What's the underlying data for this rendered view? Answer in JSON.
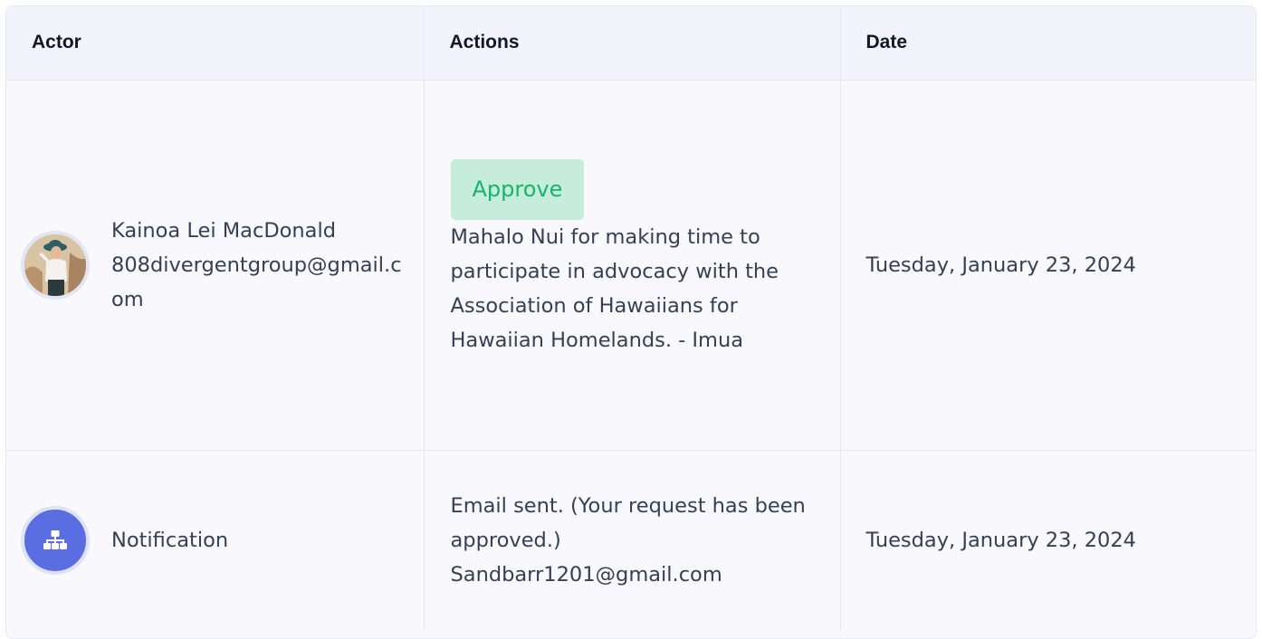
{
  "table": {
    "headers": {
      "actor": "Actor",
      "actions": "Actions",
      "date": "Date"
    },
    "rows": [
      {
        "actor_name": "Kainoa Lei MacDonald",
        "actor_email": "808divergentgroup@gmail.com",
        "avatar_icon": "user-photo-avatar",
        "action_badge": "Approve",
        "action_text": "Mahalo Nui for making time to participate in advocacy with the Association of Hawaiians for Hawaiian Homelands. - Imua",
        "date": "Tuesday, January 23, 2024"
      },
      {
        "actor_name": "Notification",
        "avatar_icon": "sitemap-icon",
        "action_text_line1": "Email sent. (Your request has been approved.)",
        "action_text_line2": "Sandbarr1201@gmail.com",
        "date": "Tuesday, January 23, 2024"
      }
    ]
  },
  "colors": {
    "approve_bg": "#c6ecdc",
    "approve_text": "#16b46c",
    "notify_avatar": "#5b6ee1",
    "header_bg": "#f2f3fb"
  }
}
